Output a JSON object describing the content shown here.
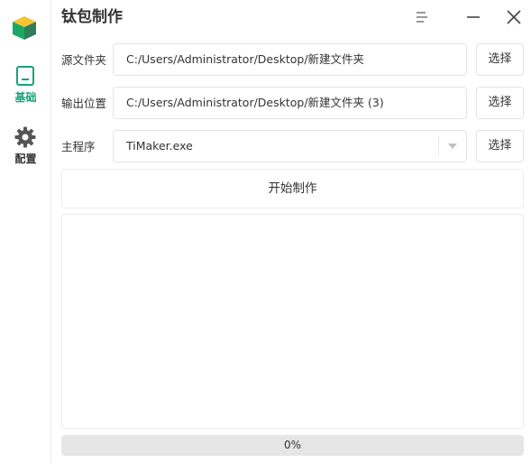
{
  "app": {
    "title": "钛包制作",
    "accent_color": "#17a37a"
  },
  "sidebar": {
    "items": [
      {
        "label": "基础",
        "icon": "monitor-icon",
        "active": true
      },
      {
        "label": "配置",
        "icon": "gear-icon",
        "active": false
      }
    ]
  },
  "window_controls": {
    "icons": [
      "menu-icon",
      "minimize-icon",
      "close-icon"
    ]
  },
  "form": {
    "source": {
      "label": "源文件夹",
      "value": "C:/Users/Administrator/Desktop/新建文件夹",
      "button": "选择"
    },
    "output": {
      "label": "输出位置",
      "value": "C:/Users/Administrator/Desktop/新建文件夹 (3)",
      "button": "选择"
    },
    "main_program": {
      "label": "主程序",
      "value": "TiMaker.exe",
      "button": "选择"
    }
  },
  "actions": {
    "start_label": "开始制作"
  },
  "log": {
    "text": ""
  },
  "progress": {
    "value": 0,
    "text": "0%"
  }
}
